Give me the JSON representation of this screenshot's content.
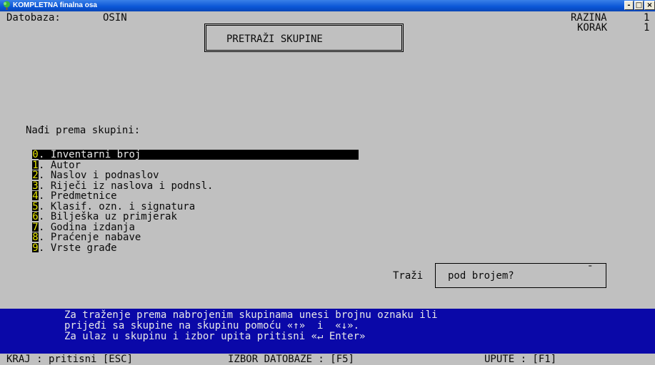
{
  "window": {
    "title": "KOMPLETNA finalna osa",
    "minimize": "-",
    "maximize": "□",
    "close": "×"
  },
  "header": {
    "database_label": "Datobaza:",
    "database_value": "OSIN",
    "screen_title": "PRETRAŽI SKUPINE",
    "level_label": "RAZINA",
    "level_value": "1",
    "step_label": "KORAK",
    "step_value": "1"
  },
  "search": {
    "prompt": "Nađi prema skupini:",
    "items": [
      {
        "key": "0",
        "label": "Inventarni broj"
      },
      {
        "key": "1",
        "label": "Autor"
      },
      {
        "key": "2",
        "label": "Naslov i podnaslov"
      },
      {
        "key": "3",
        "label": "Riječi iz naslova i podnsl."
      },
      {
        "key": "4",
        "label": "Predmetnice"
      },
      {
        "key": "5",
        "label": "Klasif. ozn. i signatura"
      },
      {
        "key": "6",
        "label": "Bilješka uz primjerak"
      },
      {
        "key": "7",
        "label": "Godina izdanja"
      },
      {
        "key": "8",
        "label": "Praćenje nabave"
      },
      {
        "key": "9",
        "label": "Vrste građe"
      }
    ],
    "item_dot": ".",
    "selected_index": 0,
    "find_label": "Traži",
    "find_field": "pod brojem?",
    "find_cursor": "¯"
  },
  "help": {
    "line1": "Za traženje prema nabrojenim skupinama unesi brojnu oznaku ili",
    "line2": "prijeđi sa skupine na skupinu pomoću «↑»  i  «↓».",
    "line3": "Za ulaz u skupinu i izbor upita pritisni «↵ Enter»"
  },
  "statusbar": {
    "exit": "KRAJ : pritisni [ESC]",
    "database": "IZBOR DATOBAZE : [F5]",
    "help": "UPUTE : [F1]"
  },
  "colors": {
    "screen_bg": "#c0c0c0",
    "help_bg": "#0a08a8",
    "key_highlight": "#e8e800",
    "selection_bg": "#000000"
  }
}
